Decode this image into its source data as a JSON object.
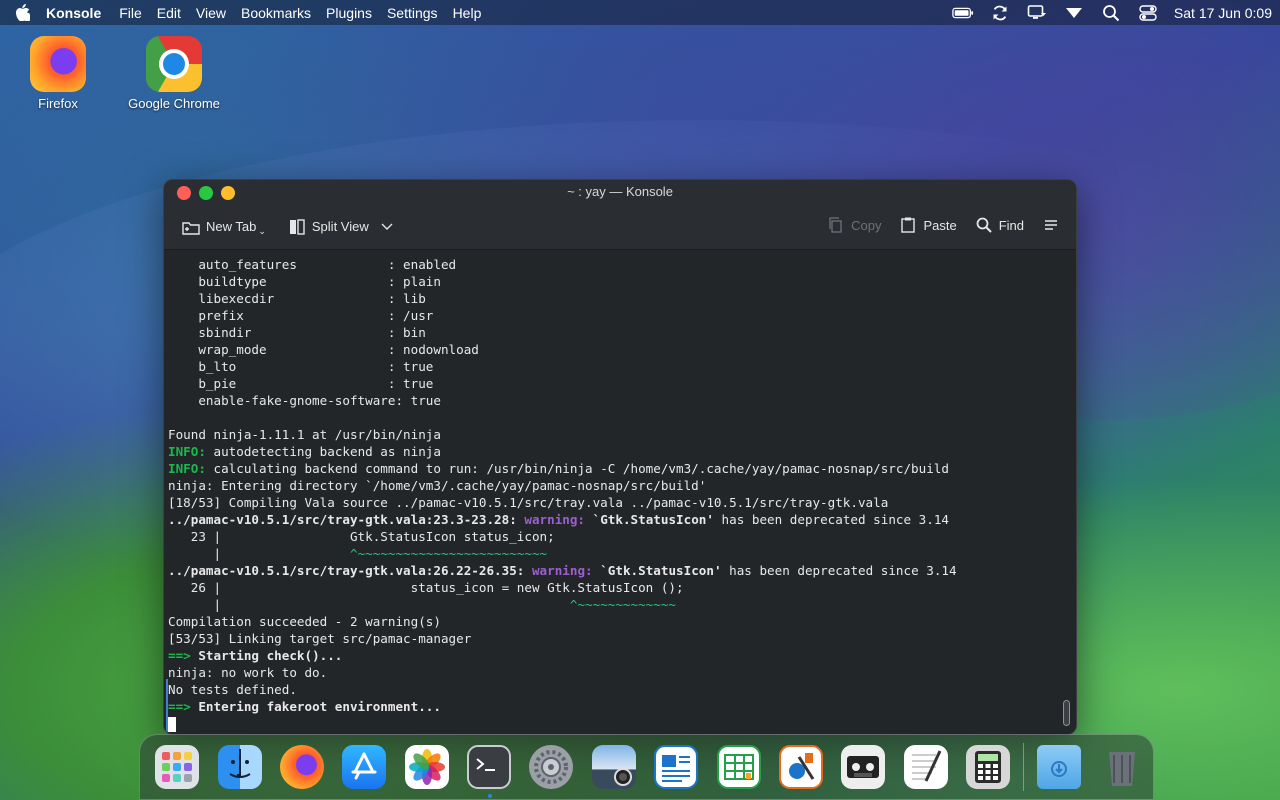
{
  "menubar": {
    "app_name": "Konsole",
    "items": [
      "File",
      "Edit",
      "View",
      "Bookmarks",
      "Plugins",
      "Settings",
      "Help"
    ],
    "clock": "Sat 17 Jun 0:09"
  },
  "desktop": {
    "icons": [
      {
        "label": "Firefox"
      },
      {
        "label": "Google Chrome"
      }
    ]
  },
  "window": {
    "title": "~ : yay — Konsole",
    "toolbar": {
      "new_tab": "New Tab",
      "split_view": "Split View",
      "copy": "Copy",
      "paste": "Paste",
      "find": "Find"
    }
  },
  "terminal": {
    "lines": [
      "    auto_features            : enabled",
      "    buildtype                : plain",
      "    libexecdir               : lib",
      "    prefix                   : /usr",
      "    sbindir                  : bin",
      "    wrap_mode                : nodownload",
      "    b_lto                    : true",
      "    b_pie                    : true",
      "    enable-fake-gnome-software: true",
      "",
      "Found ninja-1.11.1 at /usr/bin/ninja",
      "INFO: autodetecting backend as ninja",
      "INFO: calculating backend command to run: /usr/bin/ninja -C /home/vm3/.cache/yay/pamac-nosnap/src/build",
      "ninja: Entering directory `/home/vm3/.cache/yay/pamac-nosnap/src/build'",
      "[18/53] Compiling Vala source ../pamac-v10.5.1/src/tray.vala ../pamac-v10.5.1/src/tray-gtk.vala",
      "../pamac-v10.5.1/src/tray-gtk.vala:23.3-23.28: warning: `Gtk.StatusIcon' has been deprecated since 3.14",
      "   23 |                 Gtk.StatusIcon status_icon;",
      "      |                 ^~~~~~~~~~~~~~~~~~~~~~~~~~",
      "../pamac-v10.5.1/src/tray-gtk.vala:26.22-26.35: warning: `Gtk.StatusIcon' has been deprecated since 3.14",
      "   26 |                         status_icon = new Gtk.StatusIcon ();",
      "      |                                              ^~~~~~~~~~~~~~",
      "Compilation succeeded - 2 warning(s)",
      "[53/53] Linking target src/pamac-manager",
      "==> Starting check()...",
      "ninja: no work to do.",
      "No tests defined.",
      "==> Entering fakeroot environment..."
    ]
  },
  "dock": {
    "apps": [
      "launchpad",
      "finder",
      "firefox",
      "app-store",
      "photos",
      "terminal",
      "system-settings",
      "image-viewer",
      "writer",
      "calc",
      "draw",
      "tape",
      "text-edit",
      "calculator",
      "downloads",
      "trash"
    ],
    "running": "terminal"
  }
}
